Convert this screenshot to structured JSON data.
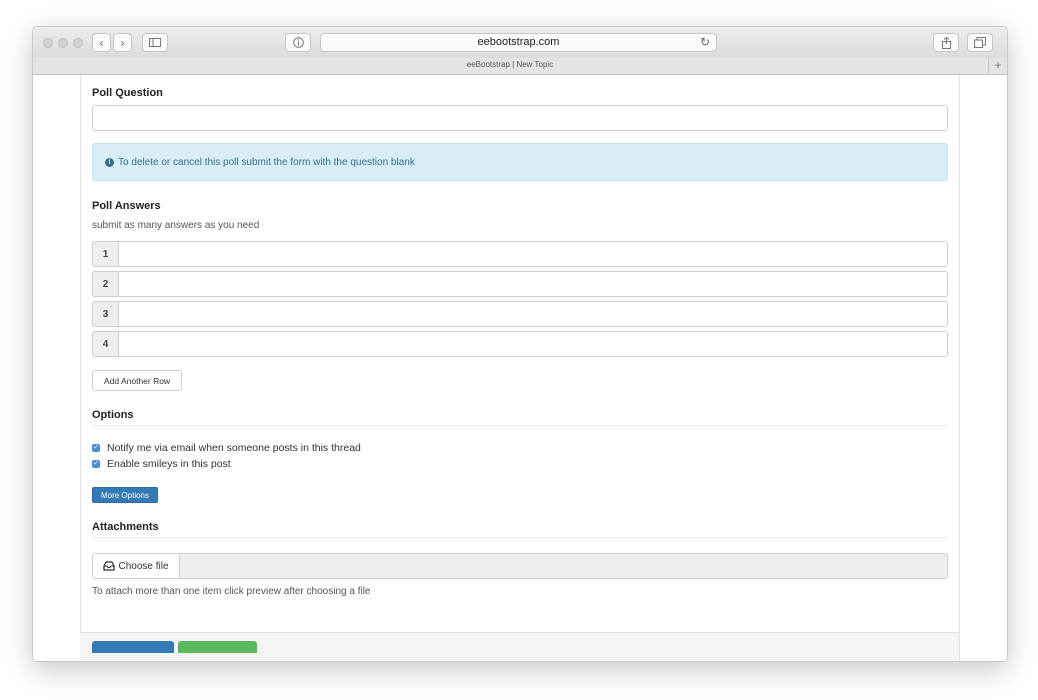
{
  "browser": {
    "url": "eebootstrap.com",
    "tab_title": "eeBootstrap | New Topic",
    "back_icon": "chevron-left-icon",
    "forward_icon": "chevron-right-icon",
    "plus": "+"
  },
  "form": {
    "poll_question_label": "Poll Question",
    "alert_text": "To delete or cancel this poll submit the form with the question blank",
    "poll_answers_label": "Poll Answers",
    "poll_answers_help": "submit as many answers as you need",
    "answers": [
      "1",
      "2",
      "3",
      "4"
    ],
    "add_row_label": "Add Another Row",
    "options_label": "Options",
    "option_notify": "Notify me via email when someone posts in this thread",
    "option_smileys": "Enable smileys in this post",
    "more_options_label": "More Options",
    "attachments_label": "Attachments",
    "choose_file_label": "Choose file",
    "attach_help": "To attach more than one item click preview after choosing a file"
  },
  "colors": {
    "primary": "#337ab7",
    "success": "#5cb85c",
    "alert_bg": "#d9edf7",
    "alert_text": "#31708f"
  }
}
